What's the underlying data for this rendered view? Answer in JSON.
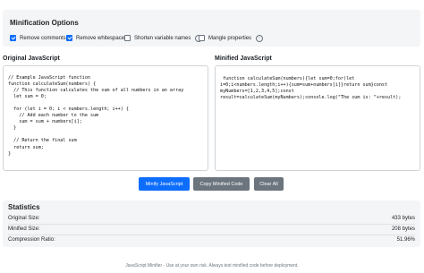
{
  "options": {
    "title": "Minification Options",
    "items": [
      {
        "label": "Remove comments",
        "checked": true
      },
      {
        "label": "Remove whitespace",
        "checked": true
      },
      {
        "label": "Shorten variable names",
        "checked": false,
        "info": "i"
      },
      {
        "label": "Mangle properties",
        "checked": false,
        "info": "i"
      }
    ]
  },
  "original": {
    "title": "Original JavaScript",
    "code": "// Example JavaScript function\nfunction calculateSum(numbers) {\n  // This function calculates the sum of all numbers in an array\n  let sum = 0;\n\n  for (let i = 0; i < numbers.length; i++) {\n    // Add each number to the sum\n    sum = sum + numbers[i];\n  }\n\n  // Return the final sum\n  return sum;\n}"
  },
  "minified": {
    "title": "Minified JavaScript",
    "code": " function calculateSum(numbers){let sum=0;for(let\ni=0;i<numbers.length;i++){sum=sum+numbers[i]}return sum}const\nmyNumbers=[1,2,3,4,5];const\nresult=calculateSum(myNumbers);console.log(\"The sum is: \"+result);"
  },
  "buttons": {
    "minify": "Minify JavaScript",
    "copy": "Copy Minified Code",
    "clear": "Clear All"
  },
  "statistics": {
    "title": "Statistics",
    "original_label": "Original Size:",
    "original_value": "433 bytes",
    "minified_label": "Minified Size:",
    "minified_value": "208 bytes",
    "ratio_label": "Compression Ratio:",
    "ratio_value": "51.96%"
  },
  "footer": "JavaScript Minifier - Use at your own risk. Always test minified code before deployment.",
  "colors": {
    "primary": "#0d6efd",
    "secondary": "#6c757d",
    "panel": "#f4f5f7"
  }
}
